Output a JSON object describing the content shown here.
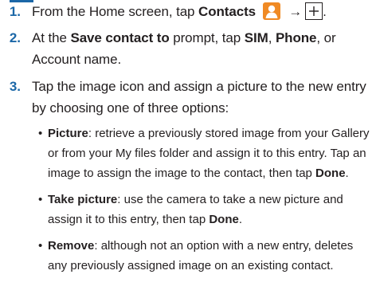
{
  "steps": [
    {
      "number": "1.",
      "prefix": "From the Home screen, tap ",
      "bold": "Contacts",
      "icons": [
        "contacts-app-icon",
        "right-arrow",
        "add-plus-button"
      ],
      "arrow": "→",
      "suffix": "."
    },
    {
      "number": "2.",
      "t1": "At the ",
      "b1": "Save contact to",
      "t2": " prompt, tap ",
      "b2": "SIM",
      "t3": ", ",
      "b3": "Phone",
      "t4": ", or Account name."
    },
    {
      "number": "3.",
      "text": "Tap the image icon and assign a picture to the new entry by choosing one of three options:"
    }
  ],
  "bullets": [
    {
      "marker": "•",
      "title": "Picture",
      "t1": ": retrieve a previously stored image from your Gallery or from your My files folder and assign it to this entry. Tap an image to assign the image to the contact, then tap ",
      "b2": "Done",
      "t2": "."
    },
    {
      "marker": "•",
      "title": "Take picture",
      "t1": ": use the camera to take a new picture and assign it to this entry, then tap ",
      "b2": "Done",
      "t2": "."
    },
    {
      "marker": "•",
      "title": "Remove",
      "t1": ": although not an option with a new entry, deletes any previously assigned image on an existing contact."
    }
  ],
  "colors": {
    "accent": "#1b67a7",
    "contacts_icon": "#f08a24",
    "text": "#231f20"
  }
}
